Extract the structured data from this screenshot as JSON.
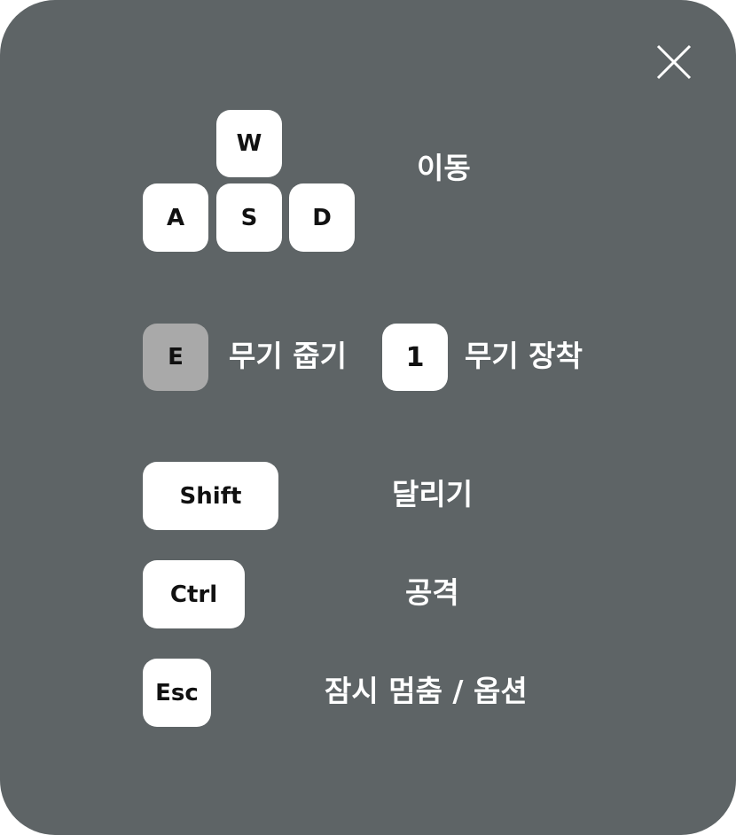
{
  "close_icon": "close-icon",
  "colors": {
    "panel_bg": "#5e6466",
    "key_bg": "#ffffff",
    "key_inactive_bg": "#a9a9a9",
    "key_text": "#111111",
    "label_text": "#ffffff"
  },
  "move": {
    "keys": {
      "w": "W",
      "a": "A",
      "s": "S",
      "d": "D"
    },
    "label": "이동"
  },
  "pickup": {
    "key": "E",
    "label": "무기 줍기"
  },
  "equip": {
    "key": "1",
    "label": "무기 장착"
  },
  "run": {
    "key": "Shift",
    "label": "달리기"
  },
  "attack": {
    "key": "Ctrl",
    "label": "공격"
  },
  "pause": {
    "key": "Esc",
    "label": "잠시 멈춤 / 옵션"
  }
}
